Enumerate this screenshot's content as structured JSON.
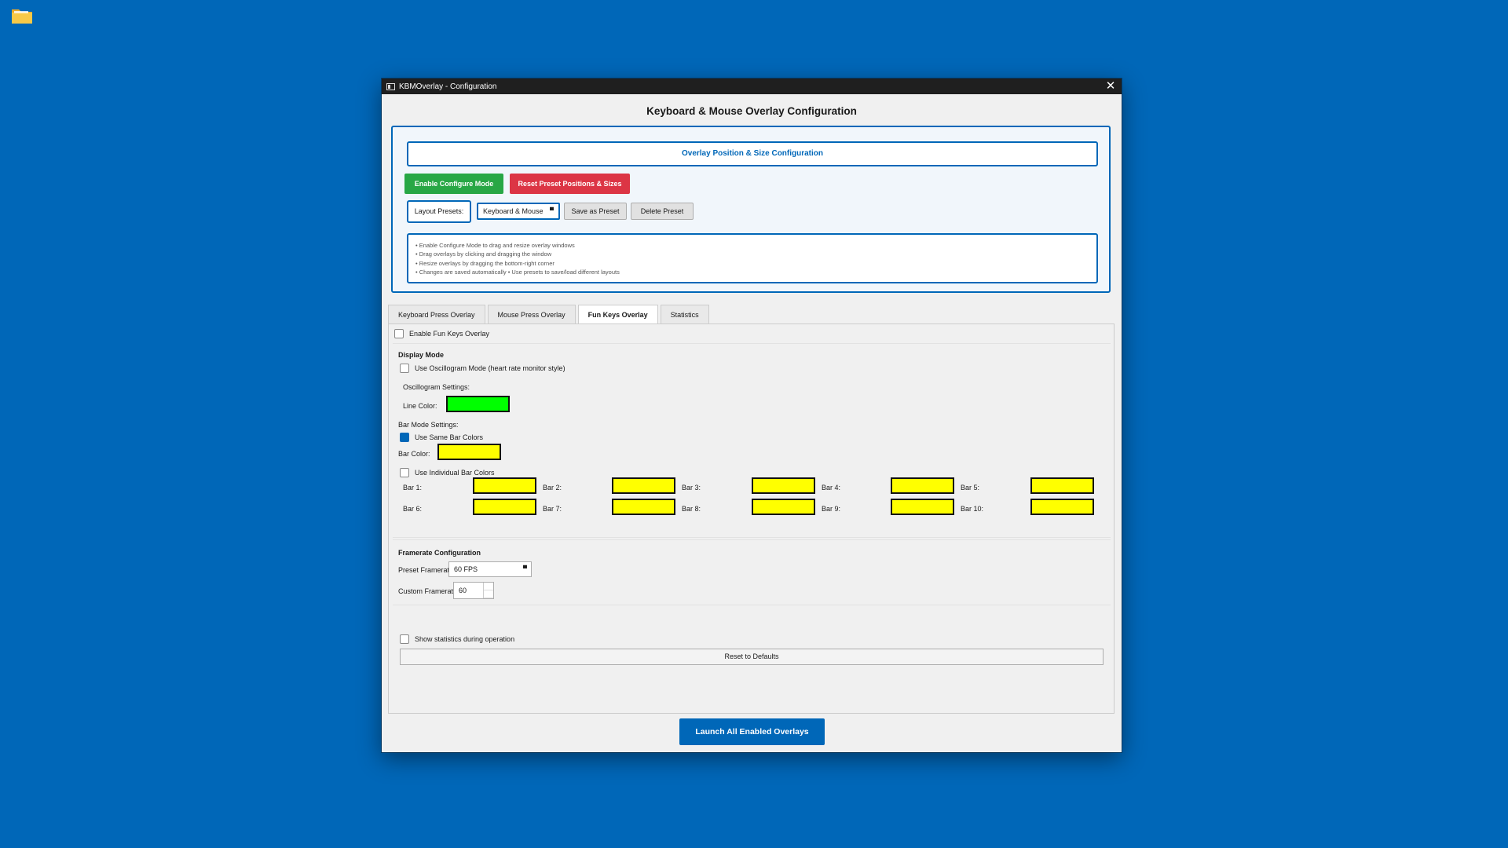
{
  "colors": {
    "desktop": "#0067b8",
    "accent": "#0067b8",
    "green_button": "#28a745",
    "red_button": "#dc3545",
    "line_color": "#00ff00",
    "bar_color": "#ffff00"
  },
  "desktop": {
    "icon": "folder-icon"
  },
  "window": {
    "title": "KBMOverlay - Configuration",
    "close_icon": "close-icon"
  },
  "main_title": "Keyboard & Mouse Overlay Configuration",
  "position_config": {
    "title": "Overlay Position & Size Configuration",
    "enable_configure_label": "Enable Configure Mode",
    "reset_preset_label": "Reset Preset Positions & Sizes",
    "layout_presets_label": "Layout Presets:",
    "preset_selected": "Keyboard & Mouse",
    "save_preset_label": "Save as Preset",
    "delete_preset_label": "Delete Preset",
    "info_lines": [
      "• Enable Configure Mode to drag and resize overlay windows",
      "• Drag overlays by clicking and dragging the window",
      "• Resize overlays by dragging the bottom-right corner",
      "• Changes are saved automatically • Use presets to save/load different layouts"
    ]
  },
  "tabs": [
    {
      "label": "Keyboard Press Overlay",
      "active": false
    },
    {
      "label": "Mouse Press Overlay",
      "active": false
    },
    {
      "label": "Fun Keys Overlay",
      "active": true
    },
    {
      "label": "Statistics",
      "active": false
    }
  ],
  "fun_keys": {
    "enable_label": "Enable Fun Keys Overlay",
    "enable_checked": false,
    "display_mode_heading": "Display Mode",
    "oscillogram_label": "Use Oscillogram Mode (heart rate monitor style)",
    "oscillogram_checked": false,
    "oscillogram_settings_label": "Oscillogram Settings:",
    "line_color_label": "Line Color:",
    "bar_mode_settings_label": "Bar Mode Settings:",
    "same_bar_colors_label": "Use Same Bar Colors",
    "same_bar_colors_checked": true,
    "bar_color_label": "Bar Color:",
    "individual_bar_colors_label": "Use Individual Bar Colors",
    "individual_bar_colors_checked": false,
    "bars": [
      "Bar 1:",
      "Bar 2:",
      "Bar 3:",
      "Bar 4:",
      "Bar 5:",
      "Bar 6:",
      "Bar 7:",
      "Bar 8:",
      "Bar 9:",
      "Bar 10:"
    ],
    "framerate_heading": "Framerate Configuration",
    "preset_framerate_label": "Preset Framerate:",
    "preset_framerate_value": "60 FPS",
    "custom_framerate_label": "Custom Framerate:",
    "custom_framerate_value": "60",
    "show_stats_label": "Show statistics during operation",
    "show_stats_checked": false,
    "reset_label": "Reset to Defaults"
  },
  "launch_label": "Launch All Enabled Overlays"
}
